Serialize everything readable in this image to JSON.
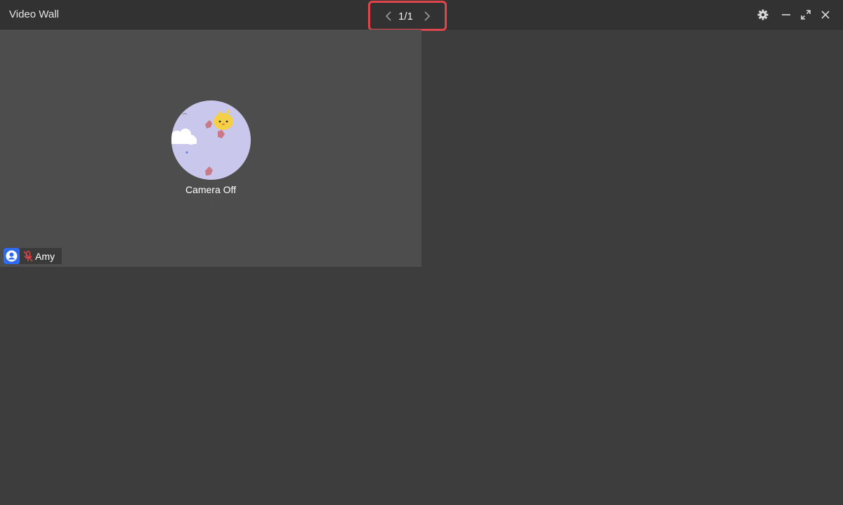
{
  "window": {
    "title": "Video Wall"
  },
  "pager": {
    "page_text": "1/1",
    "prev_icon": "chevron-left-icon",
    "next_icon": "chevron-right-icon",
    "highlight_color": "#e0454b"
  },
  "controls": {
    "settings_icon": "gear-icon",
    "minimize_icon": "minimize-icon",
    "fullscreen_icon": "expand-icon",
    "close_icon": "close-icon"
  },
  "tile": {
    "status_text": "Camera Off",
    "participant_name": "Amy",
    "user_icon": "user-icon",
    "mic_icon": "mic-off-icon",
    "mic_state_color": "#e0454b",
    "badge_color": "#2f6bf0"
  }
}
